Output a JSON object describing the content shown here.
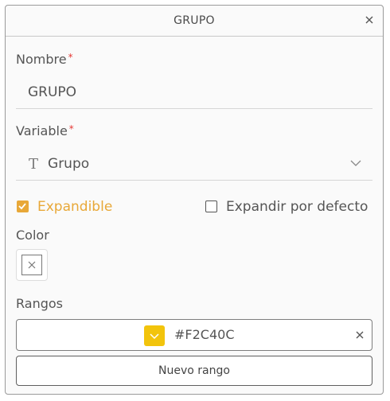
{
  "dialog": {
    "title": "GRUPO",
    "close_icon": "close-icon"
  },
  "fields": {
    "nombre": {
      "label": "Nombre",
      "required_mark": "*",
      "value": "GRUPO"
    },
    "variable": {
      "label": "Variable",
      "required_mark": "*",
      "type_icon": "T",
      "value": "Grupo",
      "dropdown_icon": "chevron-down-icon"
    }
  },
  "options": {
    "expandible": {
      "label": "Expandible",
      "checked": true
    },
    "expandir_por_defecto": {
      "label": "Expandir por defecto",
      "checked": false
    }
  },
  "color": {
    "label": "Color",
    "value_icon": "empty-color-icon"
  },
  "rangos": {
    "label": "Rangos",
    "items": [
      {
        "color": "#F2C40C",
        "hex_label": "#F2C40C"
      }
    ],
    "new_button_label": "Nuevo rango"
  },
  "colors": {
    "accent": "#E8A838",
    "required": "#E53935",
    "range_swatch": "#F2C40C"
  }
}
